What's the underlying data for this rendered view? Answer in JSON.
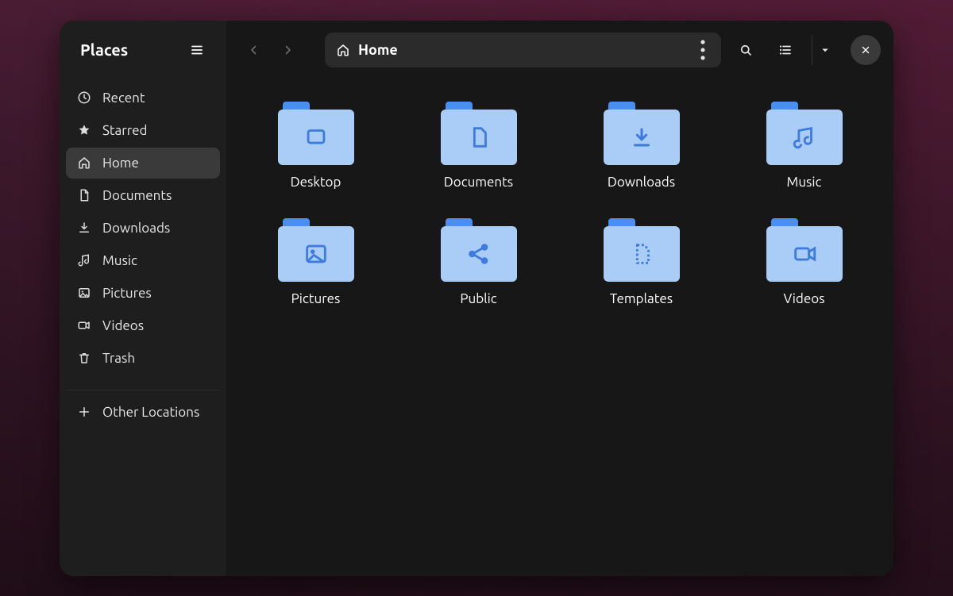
{
  "sidebar": {
    "title": "Places",
    "items": [
      {
        "id": "recent",
        "label": "Recent",
        "icon": "clock-icon",
        "active": false
      },
      {
        "id": "starred",
        "label": "Starred",
        "icon": "star-icon",
        "active": false
      },
      {
        "id": "home",
        "label": "Home",
        "icon": "home-icon",
        "active": true
      },
      {
        "id": "documents",
        "label": "Documents",
        "icon": "document-icon",
        "active": false
      },
      {
        "id": "downloads",
        "label": "Downloads",
        "icon": "download-icon",
        "active": false
      },
      {
        "id": "music",
        "label": "Music",
        "icon": "music-icon",
        "active": false
      },
      {
        "id": "pictures",
        "label": "Pictures",
        "icon": "picture-icon",
        "active": false
      },
      {
        "id": "videos",
        "label": "Videos",
        "icon": "video-icon",
        "active": false
      },
      {
        "id": "trash",
        "label": "Trash",
        "icon": "trash-icon",
        "active": false
      }
    ],
    "other_locations_label": "Other Locations"
  },
  "toolbar": {
    "back_enabled": false,
    "forward_enabled": false,
    "path_label": "Home"
  },
  "folders": [
    {
      "label": "Desktop",
      "glyph": "desktop"
    },
    {
      "label": "Documents",
      "glyph": "document"
    },
    {
      "label": "Downloads",
      "glyph": "download"
    },
    {
      "label": "Music",
      "glyph": "music"
    },
    {
      "label": "Pictures",
      "glyph": "picture"
    },
    {
      "label": "Public",
      "glyph": "share"
    },
    {
      "label": "Templates",
      "glyph": "template"
    },
    {
      "label": "Videos",
      "glyph": "video"
    }
  ]
}
